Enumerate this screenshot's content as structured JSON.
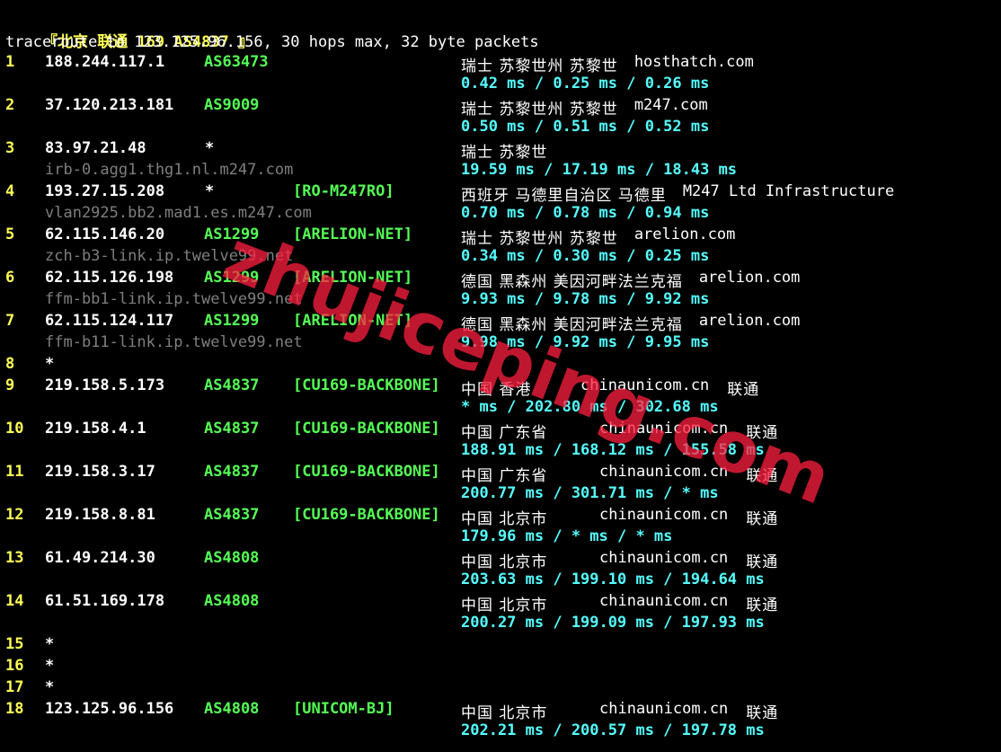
{
  "header": {
    "title_prefix": "『北京 联通 ",
    "title_tag": "169 AS4837",
    "title_suffix": " 』",
    "command": "traceroute to 123.125.96.156, 30 hops max, 32 byte packets"
  },
  "hops": [
    {
      "n": "1",
      "ip": "188.244.117.1",
      "as": "AS63473",
      "tag": "",
      "geo": "瑞士 苏黎世州 苏黎世",
      "org": "hosthatch.com",
      "host": "",
      "rtt": "0.42 ms / 0.25 ms / 0.26 ms"
    },
    {
      "n": "2",
      "ip": "37.120.213.181",
      "as": "AS9009",
      "tag": "",
      "geo": "瑞士 苏黎世州 苏黎世",
      "org": "m247.com",
      "host": "",
      "rtt": "0.50 ms / 0.51 ms / 0.52 ms"
    },
    {
      "n": "3",
      "ip": "83.97.21.48",
      "as": "*",
      "tag": "",
      "geo": "瑞士 苏黎世",
      "org": "",
      "host": "irb-0.agg1.thg1.nl.m247.com",
      "rtt": "19.59 ms / 17.19 ms / 18.43 ms"
    },
    {
      "n": "4",
      "ip": "193.27.15.208",
      "as": "*",
      "tag": "[RO-M247RO]",
      "geo": "西班牙 马德里自治区 马德里",
      "org": "M247 Ltd Infrastructure",
      "host": "vlan2925.bb2.mad1.es.m247.com",
      "rtt": "0.70 ms / 0.78 ms / 0.94 ms"
    },
    {
      "n": "5",
      "ip": "62.115.146.20",
      "as": "AS1299",
      "tag": "[ARELION-NET]",
      "geo": "瑞士 苏黎世州 苏黎世",
      "org": "arelion.com",
      "host": "zch-b3-link.ip.twelve99.net",
      "rtt": "0.34 ms / 0.30 ms / 0.25 ms"
    },
    {
      "n": "6",
      "ip": "62.115.126.198",
      "as": "AS1299",
      "tag": "[ARELION-NET]",
      "geo": "德国 黑森州 美因河畔法兰克福",
      "org": "arelion.com",
      "host": "ffm-bb1-link.ip.twelve99.net",
      "rtt": "9.93 ms / 9.78 ms / 9.92 ms"
    },
    {
      "n": "7",
      "ip": "62.115.124.117",
      "as": "AS1299",
      "tag": "[ARELION-NET]",
      "geo": "德国 黑森州 美因河畔法兰克福",
      "org": "arelion.com",
      "host": "ffm-b11-link.ip.twelve99.net",
      "rtt": "9.98 ms / 9.92 ms / 9.95 ms"
    },
    {
      "n": "8",
      "star": "*"
    },
    {
      "n": "9",
      "ip": "219.158.5.173",
      "as": "AS4837",
      "tag": "[CU169-BACKBONE]",
      "geo": "中国 香港",
      "org": "chinaunicom.cn",
      "isp": "联通",
      "host": "",
      "rtt": "* ms / 202.80 ms / 302.68 ms"
    },
    {
      "n": "10",
      "ip": "219.158.4.1",
      "as": "AS4837",
      "tag": "[CU169-BACKBONE]",
      "geo": "中国 广东省",
      "org": "chinaunicom.cn",
      "isp": "联通",
      "host": "",
      "rtt": "188.91 ms / 168.12 ms / 155.58 ms"
    },
    {
      "n": "11",
      "ip": "219.158.3.17",
      "as": "AS4837",
      "tag": "[CU169-BACKBONE]",
      "geo": "中国 广东省",
      "org": "chinaunicom.cn",
      "isp": "联通",
      "host": "",
      "rtt": "200.77 ms / 301.71 ms / * ms"
    },
    {
      "n": "12",
      "ip": "219.158.8.81",
      "as": "AS4837",
      "tag": "[CU169-BACKBONE]",
      "geo": "中国 北京市",
      "org": "chinaunicom.cn",
      "isp": "联通",
      "host": "",
      "rtt": "179.96 ms / * ms / * ms"
    },
    {
      "n": "13",
      "ip": "61.49.214.30",
      "as": "AS4808",
      "tag": "",
      "geo": "中国 北京市",
      "org": "chinaunicom.cn",
      "isp": "联通",
      "host": "",
      "rtt": "203.63 ms / 199.10 ms / 194.64 ms"
    },
    {
      "n": "14",
      "ip": "61.51.169.178",
      "as": "AS4808",
      "tag": "",
      "geo": "中国 北京市",
      "org": "chinaunicom.cn",
      "isp": "联通",
      "host": "",
      "rtt": "200.27 ms / 199.09 ms / 197.93 ms"
    },
    {
      "n": "15",
      "star": "*"
    },
    {
      "n": "16",
      "star": "*"
    },
    {
      "n": "17",
      "star": "*"
    },
    {
      "n": "18",
      "ip": "123.125.96.156",
      "as": "AS4808",
      "tag": "[UNICOM-BJ]",
      "geo": "中国 北京市",
      "org": "chinaunicom.cn",
      "isp": "联通",
      "host": "",
      "rtt": "202.21 ms / 200.57 ms / 197.78 ms"
    }
  ],
  "watermark": "zhujiceping.com",
  "colors": {
    "background": "#000000",
    "hop_number": "#ffff55",
    "asn": "#55ff55",
    "rtt": "#55ffff",
    "hostname": "#7f7f7f",
    "watermark": "#ff1f3f"
  }
}
